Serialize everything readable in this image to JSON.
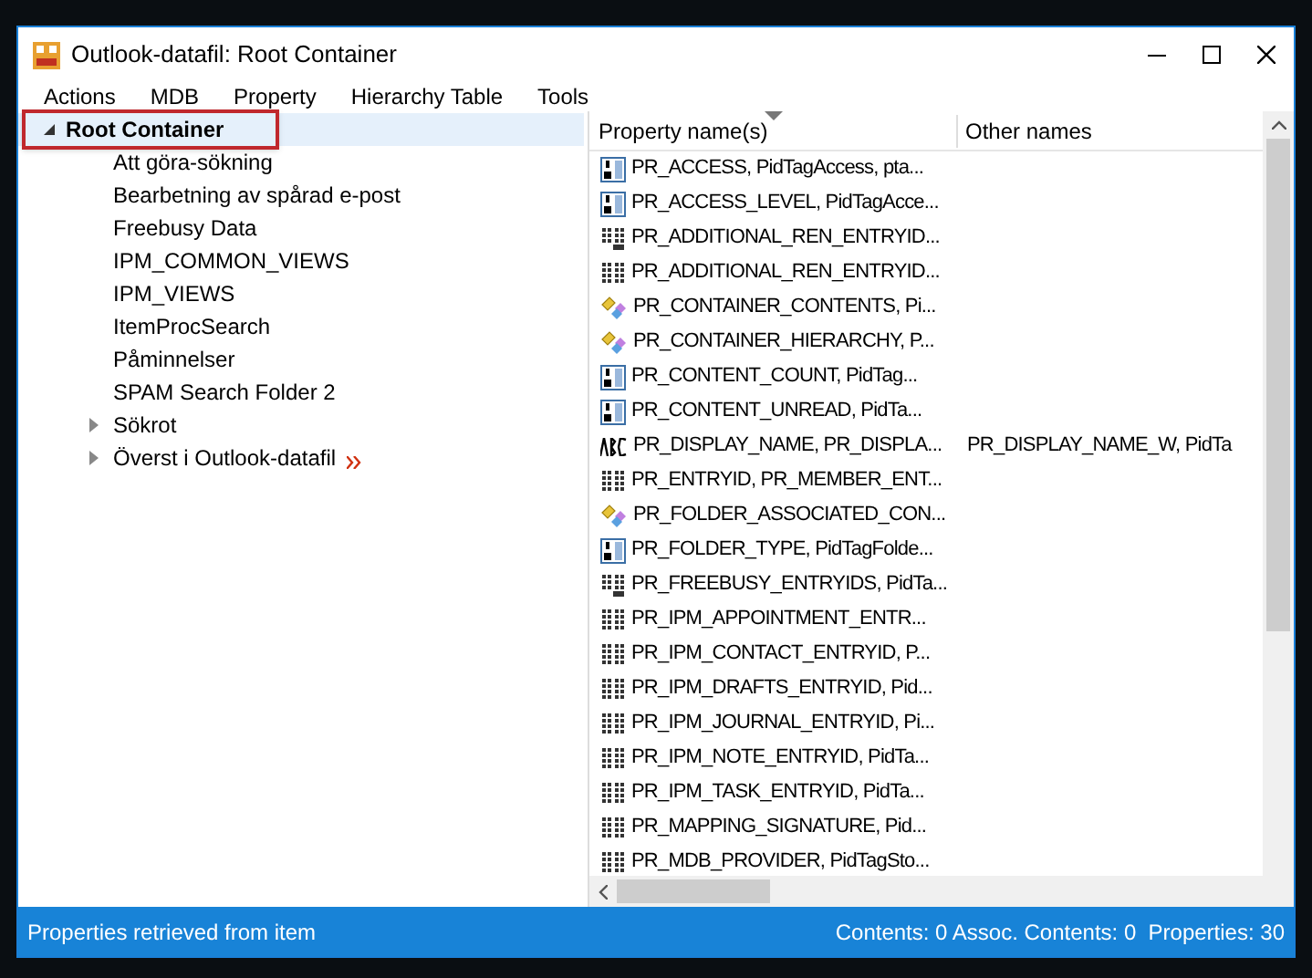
{
  "window": {
    "title": "Outlook-datafil: Root Container"
  },
  "menu": [
    "Actions",
    "MDB",
    "Property",
    "Hierarchy Table",
    "Tools"
  ],
  "tree": {
    "label": "Root Container",
    "expanded": true,
    "selected": true,
    "children": [
      {
        "label": "Att göra-sökning",
        "has_children": false
      },
      {
        "label": "Bearbetning av spårad e-post",
        "has_children": false
      },
      {
        "label": "Freebusy Data",
        "has_children": false
      },
      {
        "label": "IPM_COMMON_VIEWS",
        "has_children": false
      },
      {
        "label": "IPM_VIEWS",
        "has_children": false
      },
      {
        "label": "ItemProcSearch",
        "has_children": false
      },
      {
        "label": "Påminnelser",
        "has_children": false
      },
      {
        "label": "SPAM Search Folder 2",
        "has_children": false
      },
      {
        "label": "Sökrot",
        "has_children": true
      },
      {
        "label": "Överst i Outlook-datafil",
        "has_children": true,
        "shortcut": true
      }
    ]
  },
  "table": {
    "columns": [
      "Property name(s)",
      "Other names"
    ],
    "rows": [
      {
        "kind": "number",
        "name": "PR_ACCESS, PidTagAccess, pta..."
      },
      {
        "kind": "number",
        "name": "PR_ACCESS_LEVEL, PidTagAcce..."
      },
      {
        "kind": "binary-multi",
        "name": "PR_ADDITIONAL_REN_ENTRYID..."
      },
      {
        "kind": "binary",
        "name": "PR_ADDITIONAL_REN_ENTRYID..."
      },
      {
        "kind": "object",
        "name": "PR_CONTAINER_CONTENTS, Pi..."
      },
      {
        "kind": "object",
        "name": "PR_CONTAINER_HIERARCHY, P..."
      },
      {
        "kind": "number",
        "name": "PR_CONTENT_COUNT, PidTag..."
      },
      {
        "kind": "number",
        "name": "PR_CONTENT_UNREAD, PidTa..."
      },
      {
        "kind": "string",
        "name": "PR_DISPLAY_NAME, PR_DISPLA...",
        "other": "PR_DISPLAY_NAME_W, PidTa"
      },
      {
        "kind": "binary",
        "name": "PR_ENTRYID, PR_MEMBER_ENT..."
      },
      {
        "kind": "object",
        "name": "PR_FOLDER_ASSOCIATED_CON..."
      },
      {
        "kind": "number",
        "name": "PR_FOLDER_TYPE, PidTagFolde..."
      },
      {
        "kind": "binary-multi",
        "name": "PR_FREEBUSY_ENTRYIDS, PidTa..."
      },
      {
        "kind": "binary",
        "name": "PR_IPM_APPOINTMENT_ENTR..."
      },
      {
        "kind": "binary",
        "name": "PR_IPM_CONTACT_ENTRYID, P..."
      },
      {
        "kind": "binary",
        "name": "PR_IPM_DRAFTS_ENTRYID, Pid..."
      },
      {
        "kind": "binary",
        "name": "PR_IPM_JOURNAL_ENTRYID, Pi..."
      },
      {
        "kind": "binary",
        "name": "PR_IPM_NOTE_ENTRYID, PidTa..."
      },
      {
        "kind": "binary",
        "name": "PR_IPM_TASK_ENTRYID, PidTa..."
      },
      {
        "kind": "binary",
        "name": "PR_MAPPING_SIGNATURE, Pid..."
      },
      {
        "kind": "binary",
        "name": "PR_MDB_PROVIDER, PidTagSto..."
      }
    ]
  },
  "status_bar": {
    "message": "Properties retrieved from item",
    "counts": "Contents: 0 Assoc. Contents: 0  Properties: 30"
  }
}
